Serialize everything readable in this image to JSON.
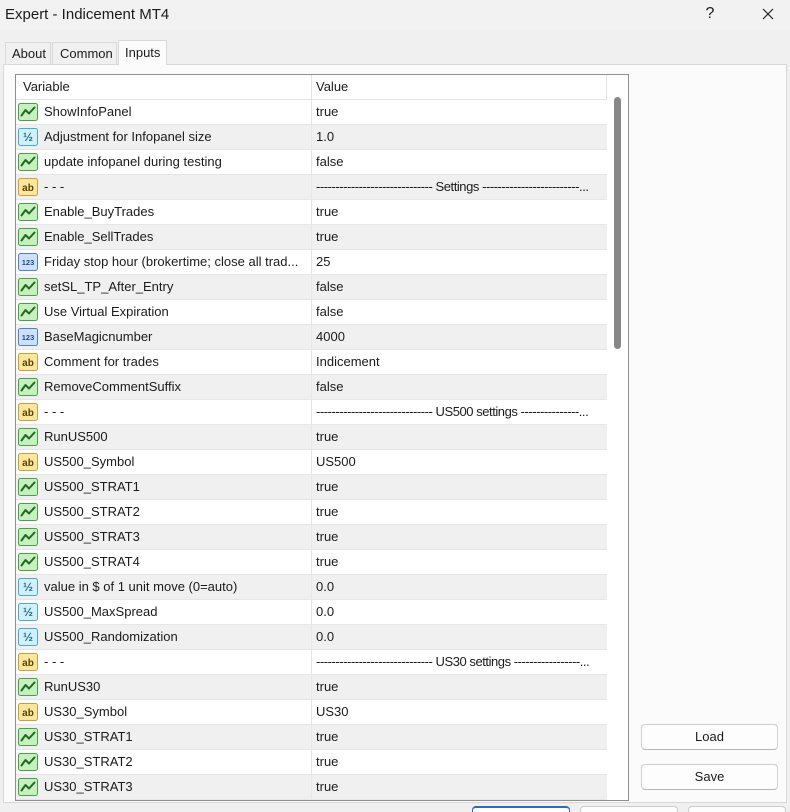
{
  "window": {
    "title": "Expert - Indicement MT4",
    "help_label": "?"
  },
  "tabs": [
    {
      "label": "About",
      "selected": false
    },
    {
      "label": "Common",
      "selected": false
    },
    {
      "label": "Inputs",
      "selected": true
    }
  ],
  "inputs": {
    "columns": [
      "Variable",
      "Value"
    ],
    "rows": [
      {
        "icon": "bool-icon",
        "variable": "ShowInfoPanel",
        "value": "true"
      },
      {
        "icon": "double-icon",
        "variable": "Adjustment for Infopanel size",
        "value": "1.0"
      },
      {
        "icon": "bool-icon",
        "variable": "update infopanel during testing",
        "value": "false"
      },
      {
        "icon": "string-icon",
        "variable": "- - -",
        "value": "------------------------------ Settings -------------------------..."
      },
      {
        "icon": "bool-icon",
        "variable": "Enable_BuyTrades",
        "value": "true"
      },
      {
        "icon": "bool-icon",
        "variable": "Enable_SellTrades",
        "value": "true"
      },
      {
        "icon": "int-icon",
        "variable": "Friday stop hour (brokertime; close all trad...",
        "value": "25"
      },
      {
        "icon": "bool-icon",
        "variable": "setSL_TP_After_Entry",
        "value": "false"
      },
      {
        "icon": "bool-icon",
        "variable": "Use Virtual Expiration",
        "value": "false"
      },
      {
        "icon": "int-icon",
        "variable": "BaseMagicnumber",
        "value": "4000"
      },
      {
        "icon": "string-icon",
        "variable": "Comment for trades",
        "value": "Indicement"
      },
      {
        "icon": "bool-icon",
        "variable": "RemoveCommentSuffix",
        "value": "false"
      },
      {
        "icon": "string-icon",
        "variable": "- - -",
        "value": "------------------------------ US500 settings ---------------..."
      },
      {
        "icon": "bool-icon",
        "variable": "RunUS500",
        "value": "true"
      },
      {
        "icon": "string-icon",
        "variable": "US500_Symbol",
        "value": "US500"
      },
      {
        "icon": "bool-icon",
        "variable": "US500_STRAT1",
        "value": "true"
      },
      {
        "icon": "bool-icon",
        "variable": "US500_STRAT2",
        "value": "true"
      },
      {
        "icon": "bool-icon",
        "variable": "US500_STRAT3",
        "value": "true"
      },
      {
        "icon": "bool-icon",
        "variable": "US500_STRAT4",
        "value": "true"
      },
      {
        "icon": "double-icon",
        "variable": "value in $ of 1 unit move (0=auto)",
        "value": "0.0"
      },
      {
        "icon": "double-icon",
        "variable": "US500_MaxSpread",
        "value": "0.0"
      },
      {
        "icon": "double-icon",
        "variable": "US500_Randomization",
        "value": "0.0"
      },
      {
        "icon": "string-icon",
        "variable": "- - -",
        "value": "------------------------------ US30 settings -----------------..."
      },
      {
        "icon": "bool-icon",
        "variable": "RunUS30",
        "value": "true"
      },
      {
        "icon": "string-icon",
        "variable": "US30_Symbol",
        "value": "US30"
      },
      {
        "icon": "bool-icon",
        "variable": "US30_STRAT1",
        "value": "true"
      },
      {
        "icon": "bool-icon",
        "variable": "US30_STRAT2",
        "value": "true"
      },
      {
        "icon": "bool-icon",
        "variable": "US30_STRAT3",
        "value": "true"
      }
    ],
    "scrollbar": {
      "position_fraction": 0,
      "visible_fraction": 0.36
    }
  },
  "icon_glyphs": {
    "string-icon": "ab",
    "int-icon": "123",
    "double-icon": "½"
  },
  "icon_colors": {
    "bool-icon": {
      "fill": "#c7efc0",
      "stroke": "#45a345",
      "mark": "#1e6b1e"
    },
    "string-icon": {
      "fill": "#fbe6a0",
      "stroke": "#c9a13a",
      "mark": "#5a4300"
    },
    "int-icon": {
      "fill": "#cfe1fa",
      "stroke": "#4b83c7",
      "mark": "#1c4e90"
    },
    "double-icon": {
      "fill": "#d3f0fa",
      "stroke": "#46abd3",
      "mark": "#1b6c8f"
    }
  },
  "buttons": {
    "load": "Load",
    "save": "Save"
  }
}
